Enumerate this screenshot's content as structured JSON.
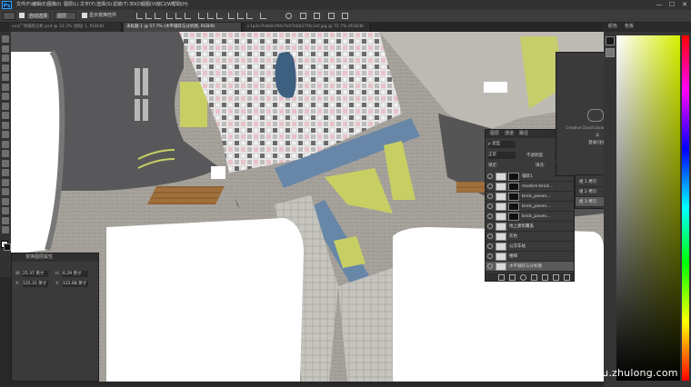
{
  "app": {
    "logo": "Ps"
  },
  "menu": [
    "文件(F)",
    "编辑(E)",
    "图像(I)",
    "图层(L)",
    "文字(Y)",
    "选择(S)",
    "滤镜(T)",
    "3D(D)",
    "视图(V)",
    "窗口(W)",
    "帮助(H)"
  ],
  "window_controls": {
    "minimize": "—",
    "maximize": "☐",
    "close": "✕"
  },
  "options": {
    "auto_select_label": "自动选择",
    "auto_select_target": "图层",
    "show_transform": "显示变换控件"
  },
  "doc_tabs": [
    {
      "label": "xxx广场铺装分析.psd @ 33.3% (图层 1, RGB/8)",
      "active": false
    },
    {
      "label": "未标题-1 @ 57.7% (水平铺装与分析图, RGB/8)",
      "active": true
    },
    {
      "label": "×1p2e7b4b0cf9fe7e07b6b27f4c2ef.jpg @ 72.7% (RGB/8)",
      "active": false
    }
  ],
  "layers_panel": {
    "tabs": [
      "图层",
      "通道",
      "路径"
    ],
    "kind_label": "ρ 类型",
    "blend_mode": "正常",
    "opacity_label": "不透明度:",
    "opacity_value": "100%",
    "lock_label": "锁定:",
    "fill_label": "填充:",
    "fill_value": "100%",
    "layers": [
      {
        "name": "铺装1",
        "mask": true,
        "selected": false
      },
      {
        "name": "modern-brick...",
        "mask": true,
        "selected": false
      },
      {
        "name": "brick_paven...",
        "mask": true,
        "selected": false
      },
      {
        "name": "brick_paven...",
        "mask": true,
        "selected": false
      },
      {
        "name": "brick_paven...",
        "mask": true,
        "selected": false
      },
      {
        "name": "地上建筑覆盖",
        "mask": false,
        "selected": false
      },
      {
        "name": "灰色",
        "mask": false,
        "selected": false
      },
      {
        "name": "公交车站",
        "mask": false,
        "selected": false
      },
      {
        "name": "楼梯",
        "mask": false,
        "selected": false
      },
      {
        "name": "水平铺装与分析图",
        "mask": false,
        "selected": true
      }
    ]
  },
  "libraries_panel": {
    "text1": "Creative Cloud Libraries 的后续操作",
    "text2": "请",
    "button": "登录/注册",
    "layer_names": [
      "组 1 拷贝",
      "组 2 拷贝",
      "组 3 拷贝"
    ]
  },
  "hud": {
    "title": "变换图层属性",
    "w_label": "W:",
    "w_value": "25.37 英寸",
    "h_label": "H:",
    "h_value": "6.29 英寸",
    "x_label": "X:",
    "x_value": "125.31 英寸",
    "y_label": "Y:",
    "y_value": "122.68 英寸"
  },
  "right_panel": {
    "tabs": [
      "颜色",
      "色板"
    ],
    "side_icons": [
      "color-icon",
      "swatches-icon"
    ]
  },
  "watermark": "edu.zhulong.com",
  "colors": {
    "accent_blue": "#31a8ff",
    "lime": "#c7cf63",
    "slate_blue": "#6887a8",
    "wood": "#a0703c"
  }
}
